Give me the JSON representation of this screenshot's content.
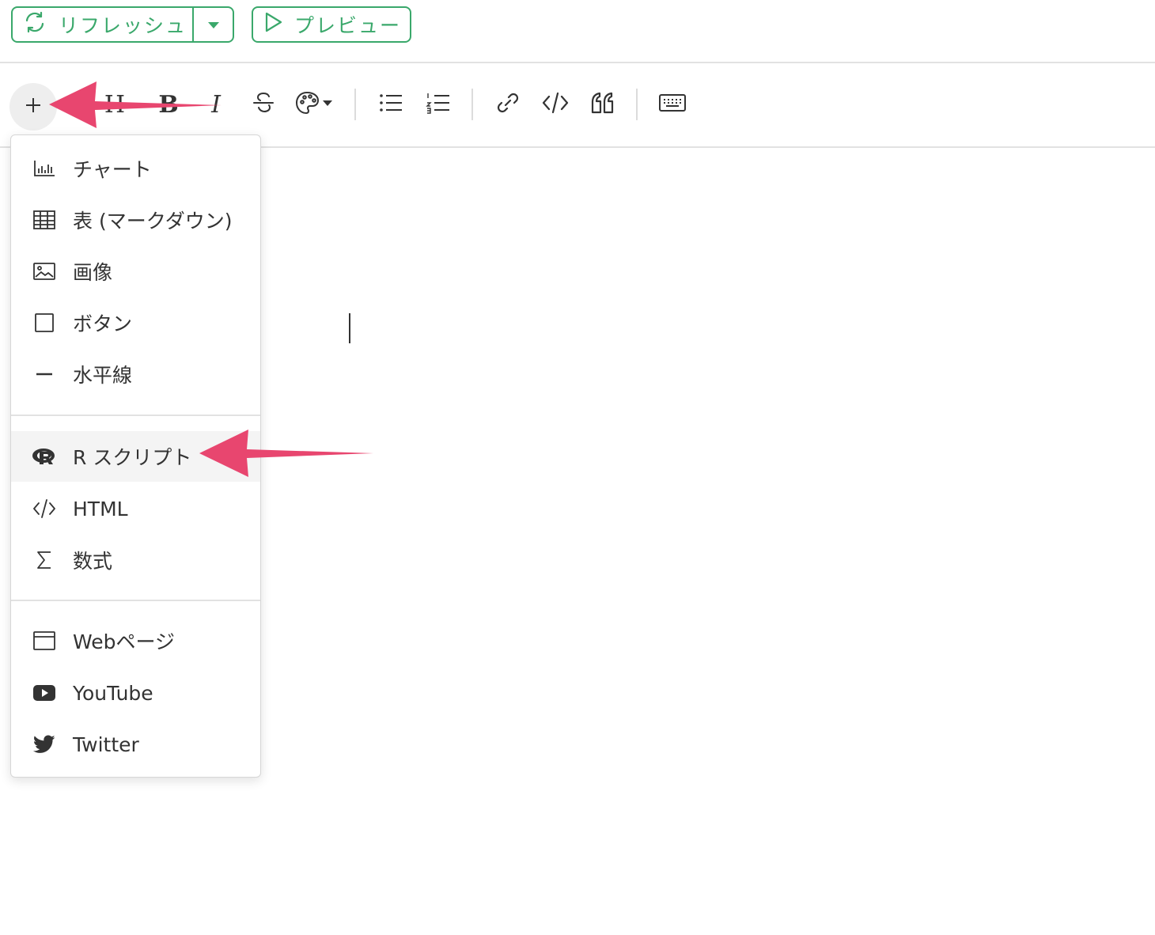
{
  "topbar": {
    "refresh_label": "リフレッシュ",
    "preview_label": "プレビュー"
  },
  "toolbar": {
    "heading_letter": "H",
    "bold_letter": "B",
    "italic_letter": "I"
  },
  "menu": {
    "items": [
      {
        "label": "チャート",
        "icon": "chart-icon"
      },
      {
        "label": "表 (マークダウン)",
        "icon": "table-icon"
      },
      {
        "label": "画像",
        "icon": "image-icon"
      },
      {
        "label": "ボタン",
        "icon": "button-icon"
      },
      {
        "label": "水平線",
        "icon": "horizontal-rule-icon"
      },
      {
        "label": "R スクリプト",
        "icon": "r-logo-icon"
      },
      {
        "label": "HTML",
        "icon": "code-icon"
      },
      {
        "label": "数式",
        "icon": "sigma-icon"
      },
      {
        "label": "Webページ",
        "icon": "browser-window-icon"
      },
      {
        "label": "YouTube",
        "icon": "youtube-icon"
      },
      {
        "label": "Twitter",
        "icon": "twitter-icon"
      }
    ]
  },
  "colors": {
    "accent_green": "#3aa86b",
    "annotation_arrow": "#e8466f"
  }
}
